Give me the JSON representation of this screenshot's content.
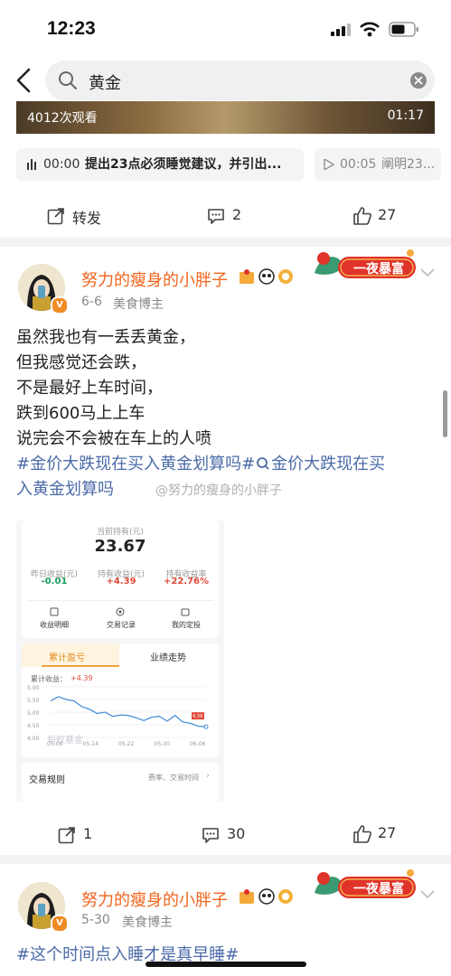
{
  "status_bar": {
    "time": "12:23"
  },
  "search": {
    "query": "黄金"
  },
  "video": {
    "views": "4012次观看",
    "duration": "01:17"
  },
  "audio_pills": [
    {
      "time": "00:00",
      "text": "提出23点必须睡觉建议，并引出..."
    },
    {
      "time": "00:05",
      "text": "阐明23..."
    }
  ],
  "post0_actions": {
    "repost": "转发",
    "comments": "2",
    "likes": "27"
  },
  "post1": {
    "username": "努力的瘦身的小胖子",
    "date": "6-6",
    "tag": "美食博主",
    "banner": "一夜暴富",
    "lines": [
      "虽然我也有一丢丢黄金，",
      "但我感觉还会跌，",
      "不是最好上车时间，",
      "跌到600马上上车",
      "说完会不会被在车上的人喷"
    ],
    "topic_line1": "#金价大跌现在买入黄金划算吗#",
    "topic_line1b": "金价大跌现在买",
    "topic_line2": "入黄金划算吗",
    "watermark": "@努力的瘦身的小胖子",
    "screenshot": {
      "hold_label": "当前持有(元)",
      "hold_value": "23.67",
      "stats": [
        {
          "label": "昨日收益(元)",
          "value": "-0.01",
          "color": "#1a9a5a"
        },
        {
          "label": "持有收益(元)",
          "value": "+4.39",
          "color": "#e04a3a"
        },
        {
          "label": "持有收益率",
          "value": "+22.76%",
          "color": "#e04a3a"
        }
      ],
      "links": [
        "收益明细",
        "交易记录",
        "我的定投"
      ],
      "tabs": [
        "累计盈亏",
        "业绩走势"
      ],
      "legend": "累计收益：",
      "legend_value": "+4.39",
      "fund_wm": "蚂蚁基金",
      "point_label": "4.39",
      "rules_title": "交易规则",
      "rules_right": "费率、交易时间",
      "chart_data": {
        "type": "line",
        "x": [
          "05-06",
          "05-14",
          "05-22",
          "05-30",
          "06-06"
        ],
        "y_ticks": [
          "5.00",
          "5.50",
          "5.00",
          "4.50",
          "4.00"
        ],
        "values": [
          5.3,
          5.45,
          5.35,
          5.3,
          5.1,
          5.0,
          4.85,
          4.9,
          4.75,
          4.8,
          4.78,
          4.7,
          4.6,
          4.72,
          4.75,
          4.58,
          4.78,
          4.55,
          4.5,
          4.4,
          4.38
        ],
        "ylim": [
          4.0,
          5.8
        ]
      }
    },
    "actions": {
      "reposts": "1",
      "comments": "30",
      "likes": "27"
    }
  },
  "post2": {
    "username": "努力的瘦身的小胖子",
    "date": "5-30",
    "tag": "美食博主",
    "banner": "一夜暴富",
    "topic": "#这个时间点入睡才是真早睡#"
  },
  "colors": {
    "username": "#f0651f",
    "topic": "#4a6aa8",
    "banner_red": "#e0332a"
  }
}
